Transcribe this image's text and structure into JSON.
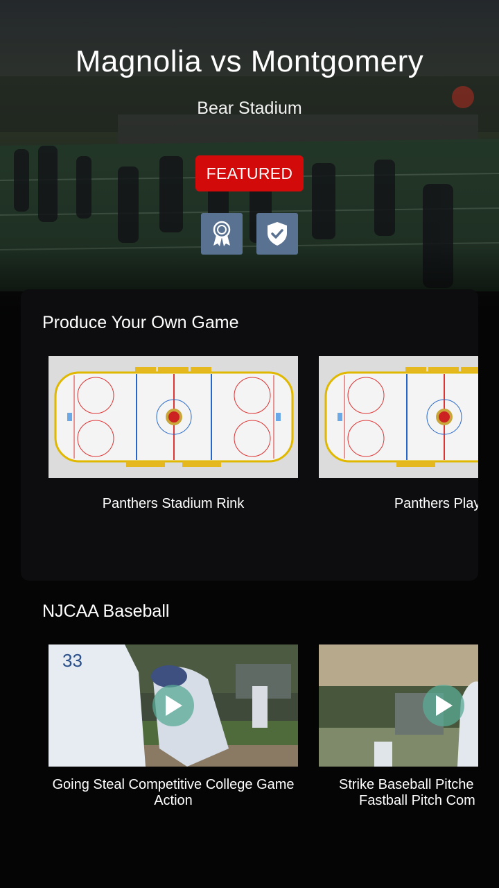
{
  "hero": {
    "title": "Magnolia vs Montgomery",
    "venue": "Bear Stadium",
    "badge": "FEATURED",
    "icons": [
      "award-ribbon-icon",
      "shield-check-icon"
    ]
  },
  "sections": [
    {
      "title": "Produce Your Own Game",
      "cards": [
        {
          "label": "Panthers Stadium Rink",
          "thumb": "hockey-rink"
        },
        {
          "label": "Panthers Player",
          "thumb": "hockey-rink"
        }
      ]
    },
    {
      "title": "NJCAA Baseball",
      "cards": [
        {
          "label_line1": "Going Steal Competitive College Game",
          "label_line2": "Action",
          "thumb": "baseball-video"
        },
        {
          "label_line1": "Strike Baseball Pitche",
          "label_line2": "Fastball Pitch Com",
          "thumb": "baseball-video"
        }
      ]
    }
  ],
  "colors": {
    "featured": "#d20a0a",
    "icon_button": "#5a7291",
    "background": "#050505"
  }
}
